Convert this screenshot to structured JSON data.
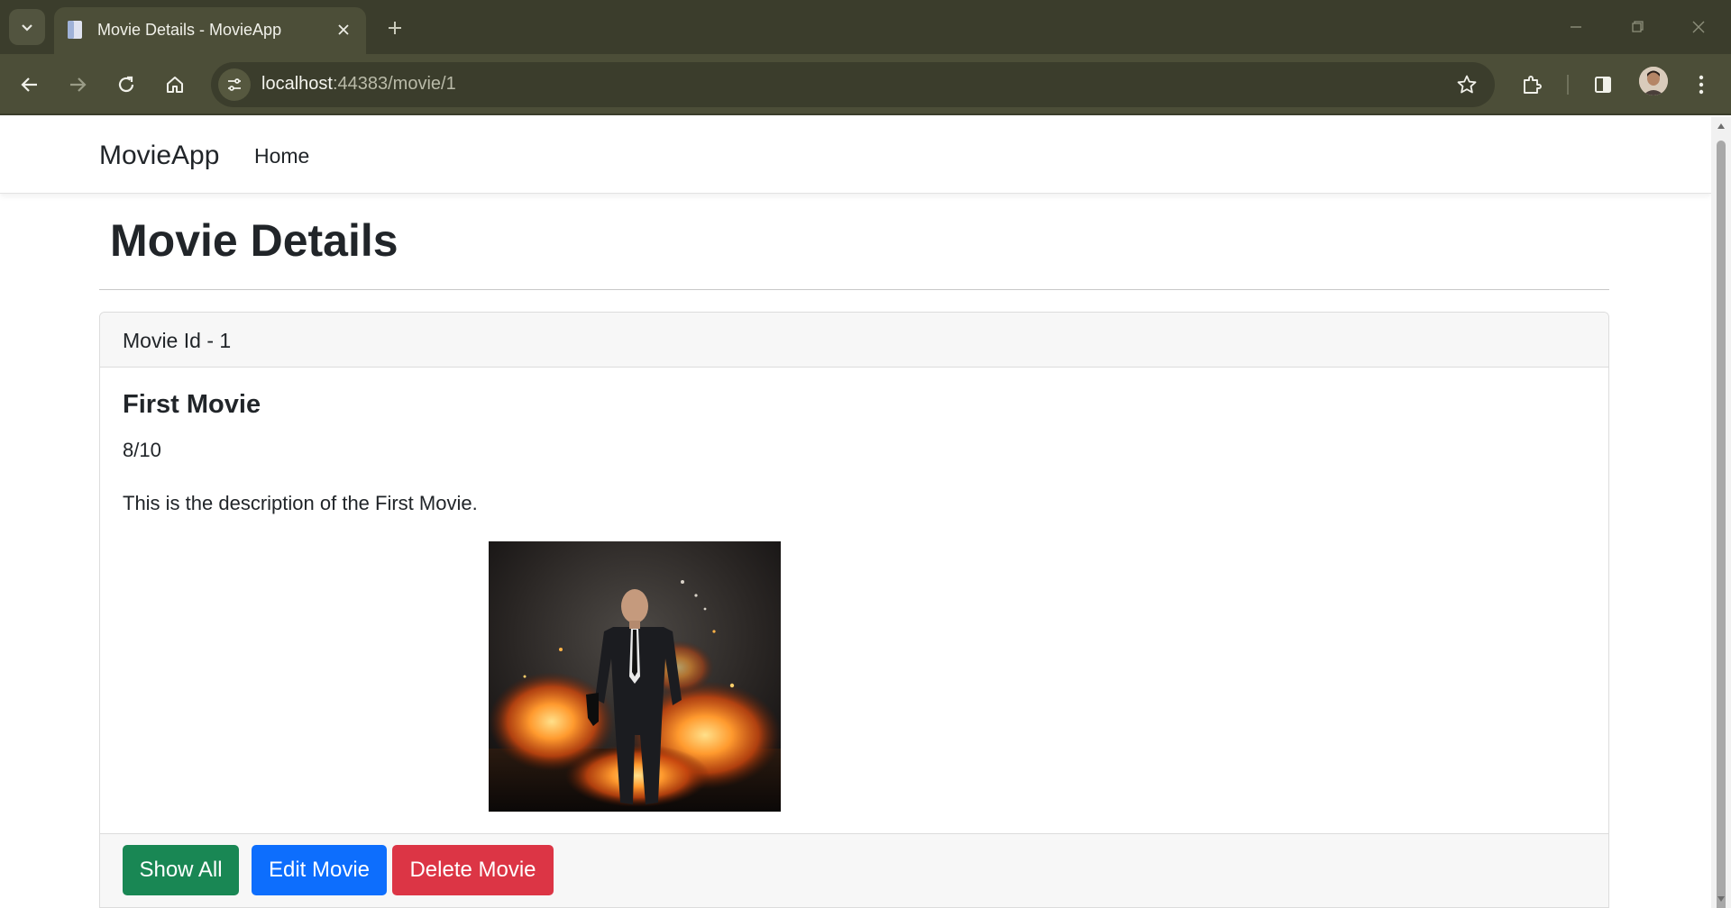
{
  "browser": {
    "tab_title": "Movie Details - MovieApp",
    "url_host": "localhost",
    "url_rest": ":44383/movie/1"
  },
  "colors": {
    "chrome_dark": "#3b3d2c",
    "chrome_toolbar": "#4c4e38",
    "success": "#198754",
    "primary": "#0d6efd",
    "danger": "#dc3545"
  },
  "icons": {
    "tab_menu": "chevron-down-icon",
    "favicon": "document-icon",
    "tab_close": "close-icon",
    "new_tab": "plus-icon",
    "back": "arrow-left-icon",
    "forward": "arrow-right-icon",
    "reload": "reload-icon",
    "home": "home-icon",
    "site_info": "tune-icon",
    "bookmark": "star-icon",
    "extensions": "puzzle-icon",
    "side_panel": "side-panel-icon",
    "profile": "avatar",
    "menu": "kebab-menu-icon"
  },
  "navbar": {
    "brand": "MovieApp",
    "home_link": "Home"
  },
  "page": {
    "title": "Movie Details"
  },
  "movie": {
    "header": "Movie Id - 1",
    "name": "First Movie",
    "rating": "8/10",
    "description": "This is the description of the First Movie."
  },
  "actions": {
    "show_all": "Show All",
    "edit": "Edit Movie",
    "delete": "Delete Movie"
  }
}
